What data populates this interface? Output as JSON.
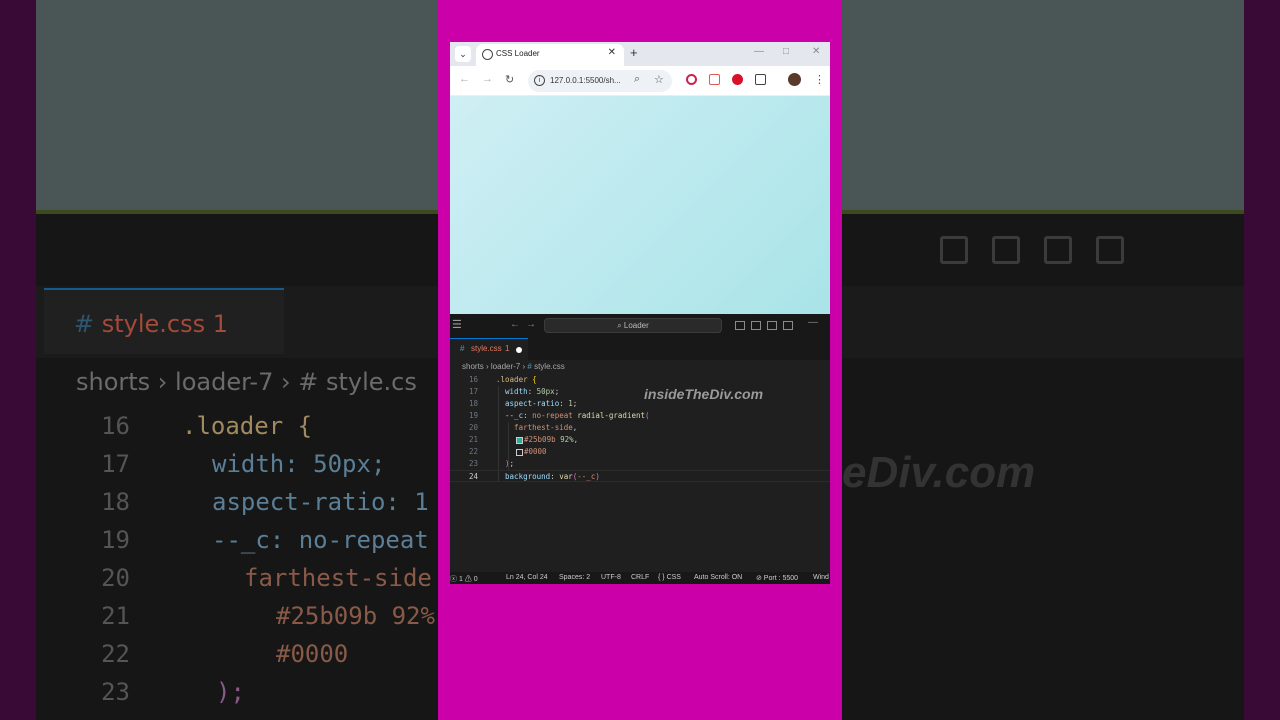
{
  "background": {
    "tab": "style.css",
    "tab_error": "1",
    "breadcrumb": "shorts › loader-7 › # style.cs",
    "watermark": "eDiv.com",
    "lines": [
      {
        "n": "16",
        "t": ".loader {"
      },
      {
        "n": "17",
        "t": "width: 50px;"
      },
      {
        "n": "18",
        "t": "aspect-ratio: 1"
      },
      {
        "n": "19",
        "t": "--_c: no-repeat"
      },
      {
        "n": "20",
        "t": "farthest-side"
      },
      {
        "n": "21",
        "t": "#25b09b 92%"
      },
      {
        "n": "22",
        "t": "#0000"
      },
      {
        "n": "23",
        "t": ");"
      }
    ]
  },
  "browser": {
    "tab_title": "CSS Loader",
    "url": "127.0.0.1:5500/sh...",
    "icons": [
      "chevron-down-icon",
      "globe-icon",
      "close-icon",
      "plus-icon",
      "minimize-icon",
      "maximize-icon",
      "back-icon",
      "forward-icon",
      "reload-icon",
      "info-icon",
      "zoom-icon",
      "star-icon",
      "record-icon",
      "extension-icon",
      "opera-icon",
      "puzzle-icon",
      "avatar",
      "menu-icon"
    ],
    "controls": {
      "dropdown": "⌄",
      "close": "✕",
      "new": "+",
      "min": "—",
      "max": "□",
      "wclose": "✕",
      "back": "←",
      "fwd": "→",
      "reload": "↻",
      "zoom": "⌕",
      "star": "☆",
      "menu": "⋮"
    }
  },
  "vscode": {
    "search": "⌕ Loader",
    "tab": {
      "hash": "#",
      "name": "style.css",
      "errors": "1"
    },
    "breadcrumb": {
      "a": "shorts",
      "b": "loader-7",
      "hash": "#",
      "c": "style.css"
    },
    "watermark": "insideTheDiv.com",
    "code": [
      {
        "n": "16",
        "p": [
          {
            "c": "sel",
            "t": ".loader "
          },
          {
            "c": "br2",
            "t": "{"
          }
        ]
      },
      {
        "n": "17",
        "p": [
          {
            "c": "prop",
            "t": "  width"
          },
          {
            "c": "pun",
            "t": ": "
          },
          {
            "c": "num",
            "t": "50px"
          },
          {
            "c": "pun",
            "t": ";"
          }
        ]
      },
      {
        "n": "18",
        "p": [
          {
            "c": "prop",
            "t": "  aspect-ratio"
          },
          {
            "c": "pun",
            "t": ": "
          },
          {
            "c": "num",
            "t": "1"
          },
          {
            "c": "pun",
            "t": ";"
          }
        ]
      },
      {
        "n": "19",
        "p": [
          {
            "c": "prop",
            "t": "  --_c"
          },
          {
            "c": "pun",
            "t": ": "
          },
          {
            "c": "str",
            "t": "no-repeat "
          },
          {
            "c": "fn",
            "t": "radial-gradient"
          },
          {
            "c": "br",
            "t": "("
          }
        ]
      },
      {
        "n": "20",
        "p": [
          {
            "c": "str",
            "t": "    farthest-side"
          },
          {
            "c": "pun",
            "t": ","
          }
        ]
      },
      {
        "n": "21",
        "sw": "#25b09b",
        "p": [
          {
            "c": "str",
            "t": "#25b09b "
          },
          {
            "c": "num",
            "t": "92%"
          },
          {
            "c": "pun",
            "t": ","
          }
        ]
      },
      {
        "n": "22",
        "sw": "#0000",
        "p": [
          {
            "c": "str",
            "t": "#0000"
          }
        ]
      },
      {
        "n": "23",
        "p": [
          {
            "c": "br",
            "t": "  )"
          },
          {
            "c": "pun",
            "t": ";"
          }
        ]
      },
      {
        "n": "24",
        "active": true,
        "p": [
          {
            "c": "prop",
            "t": "  background"
          },
          {
            "c": "pun",
            "t": ": "
          },
          {
            "c": "fn",
            "t": "var"
          },
          {
            "c": "br",
            "t": "("
          },
          {
            "c": "str",
            "t": "--_c"
          },
          {
            "c": "br",
            "t": ")"
          }
        ]
      }
    ],
    "status": {
      "problems": "ⓧ 1 ⚠ 0",
      "position": "Ln 24, Col 24",
      "spaces": "Spaces: 2",
      "encoding": "UTF-8",
      "eol": "CRLF",
      "language": "{ } CSS",
      "autoscroll": "Auto Scroll: ON",
      "port": "⊘ Port : 5500",
      "extra": "Wind"
    }
  }
}
